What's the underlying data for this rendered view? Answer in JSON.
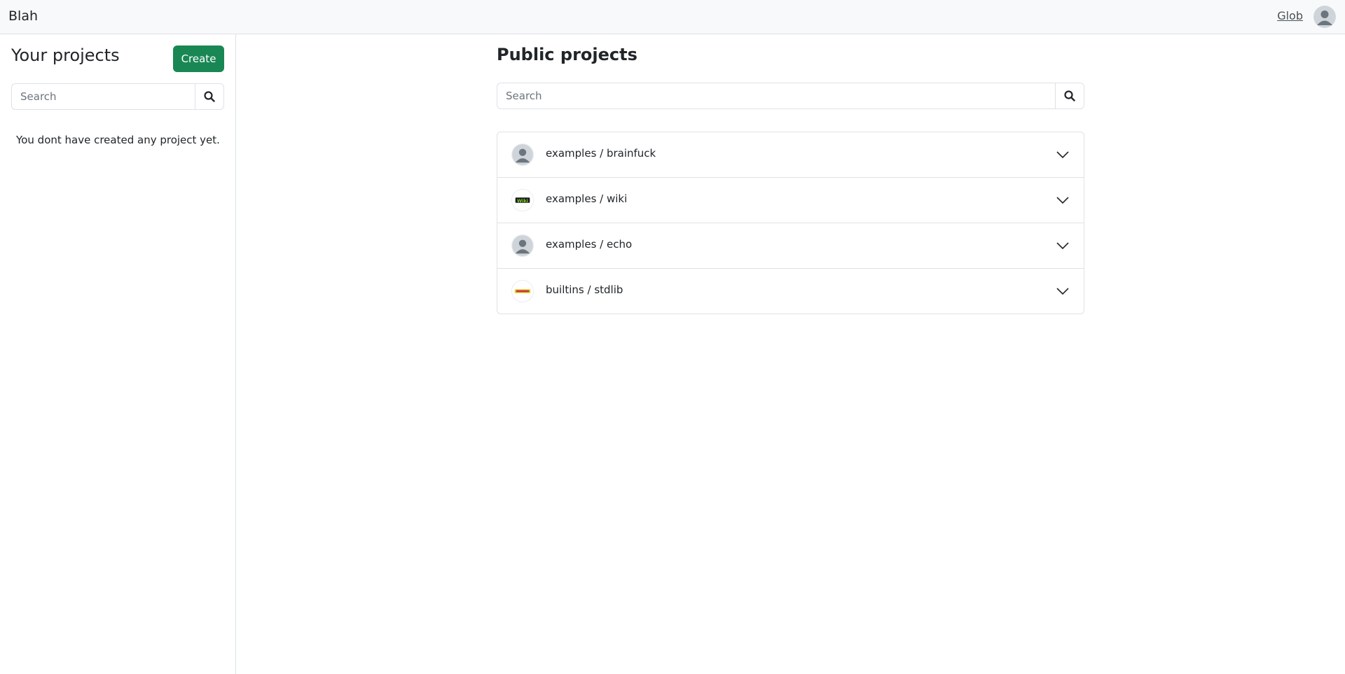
{
  "navbar": {
    "brand": "Blah",
    "user_name": "Glob",
    "avatar_icon": "user-avatar-icon"
  },
  "sidebar": {
    "title": "Your projects",
    "create_label": "Create",
    "search_placeholder": "Search",
    "empty_message": "You dont have created any project yet."
  },
  "main": {
    "title": "Public projects",
    "search_placeholder": "Search",
    "projects": [
      {
        "name": "examples / brainfuck",
        "avatar": "default-user-avatar"
      },
      {
        "name": "examples / wiki",
        "avatar": "wiki-logo"
      },
      {
        "name": "examples / echo",
        "avatar": "default-user-avatar"
      },
      {
        "name": "builtins / stdlib",
        "avatar": "stdlib-logo"
      }
    ]
  },
  "colors": {
    "primary_button": "#198754",
    "border": "#dee2e6",
    "navbar_bg": "#f8f9fa"
  }
}
